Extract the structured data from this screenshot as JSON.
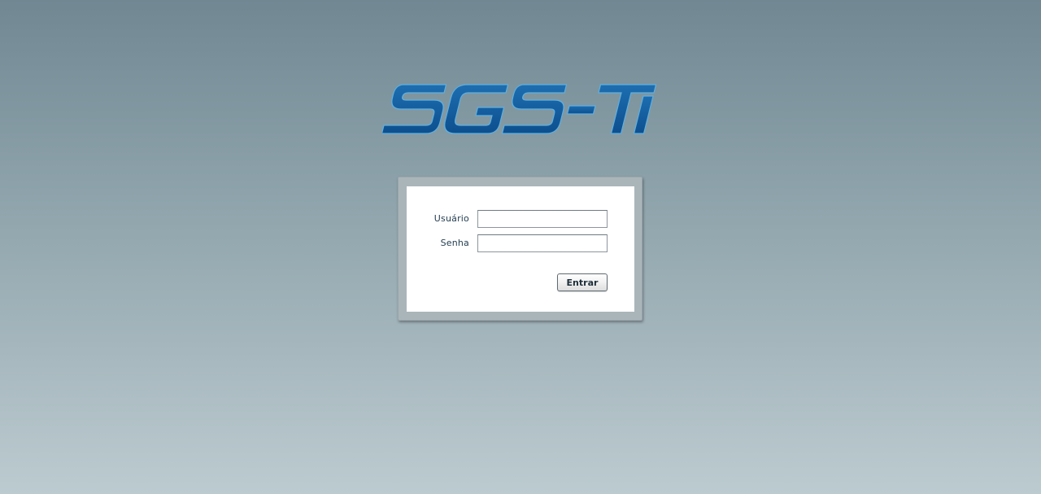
{
  "app": {
    "logo_text": "SGS-TI"
  },
  "login": {
    "username_label": "Usuário",
    "username_value": "",
    "password_label": "Senha",
    "password_value": "",
    "submit_label": "Entrar"
  },
  "colors": {
    "logo_blue": "#125a9c",
    "logo_highlight": "#5fb0e0",
    "background_top": "#718893",
    "background_bottom": "#bccbd0"
  }
}
